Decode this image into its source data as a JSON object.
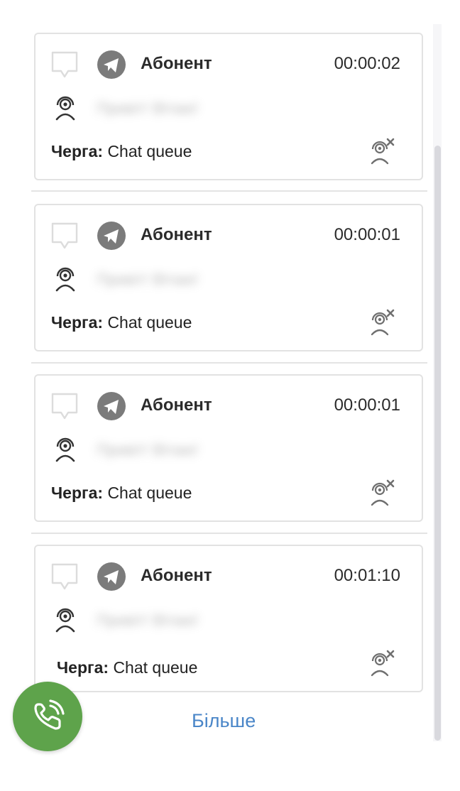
{
  "cards": [
    {
      "sender": "Абонент",
      "timer": "00:00:02",
      "preview": "Привіт! Вітаю!",
      "queue_label": "Черга:",
      "queue_value": "Chat queue"
    },
    {
      "sender": "Абонент",
      "timer": "00:00:01",
      "preview": "Привіт! Вітаю!",
      "queue_label": "Черга:",
      "queue_value": "Chat queue"
    },
    {
      "sender": "Абонент",
      "timer": "00:00:01",
      "preview": "Привіт! Вітаю!",
      "queue_label": "Черга:",
      "queue_value": "Chat queue"
    },
    {
      "sender": "Абонент",
      "timer": "00:01:10",
      "preview": "Привіт! Вітаю!",
      "queue_label": "Черга:",
      "queue_value": "Chat queue"
    }
  ],
  "more_label": "Більше",
  "colors": {
    "accent": "#4a86c8",
    "call_button": "#5ea34b",
    "icon_gray": "#7b7b7b"
  },
  "icons": [
    "chat-bubble-icon",
    "telegram-icon",
    "agent-headset-icon",
    "unassign-agent-icon",
    "phone-call-icon"
  ]
}
